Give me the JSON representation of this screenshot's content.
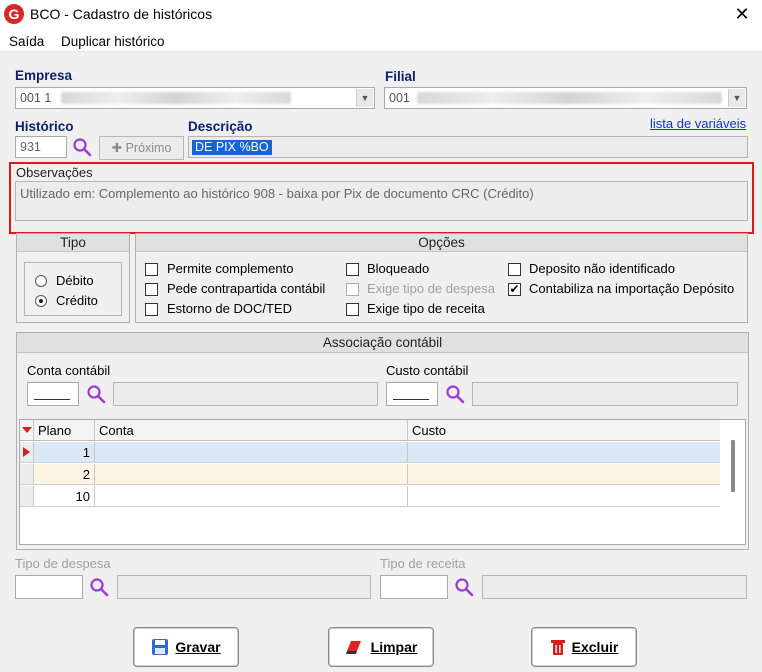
{
  "window": {
    "title": "BCO - Cadastro de históricos",
    "icon_letter": "G",
    "close_glyph": "✕"
  },
  "menu": [
    "Saída",
    "Duplicar histórico"
  ],
  "empresa": {
    "label": "Empresa",
    "value": "001 1"
  },
  "filial": {
    "label": "Filial",
    "value": "001"
  },
  "historico": {
    "label": "Histórico",
    "value": "931",
    "proximo_label": "Próximo"
  },
  "descricao": {
    "label": "Descrição",
    "value": "DE PIX %BO"
  },
  "variaveis_link": "lista de variáveis",
  "observacoes": {
    "label": "Observações",
    "value": "Utilizado em: Complemento ao histórico 908 - baixa por Pix de documento CRC (Crédito)"
  },
  "tipo": {
    "title": "Tipo",
    "options": [
      "Débito",
      "Crédito"
    ],
    "selected": "Crédito"
  },
  "opcoes": {
    "title": "Opções",
    "items": [
      {
        "label": "Permite complemento",
        "checked": false,
        "disabled": false
      },
      {
        "label": "Pede contrapartida contábil",
        "checked": false,
        "disabled": false
      },
      {
        "label": "Estorno de DOC/TED",
        "checked": false,
        "disabled": false
      },
      {
        "label": "Bloqueado",
        "checked": false,
        "disabled": false
      },
      {
        "label": "Exige tipo de despesa",
        "checked": false,
        "disabled": true
      },
      {
        "label": "Exige tipo de receita",
        "checked": false,
        "disabled": false
      },
      {
        "label": "Deposito não identificado",
        "checked": false,
        "disabled": false
      },
      {
        "label": "Contabiliza na importação Depósito",
        "checked": true,
        "disabled": false
      }
    ]
  },
  "associacao": {
    "title": "Associação contábil",
    "conta_label": "Conta contábil",
    "custo_label": "Custo contábil",
    "columns": [
      "Plano",
      "Conta",
      "Custo"
    ],
    "rows": [
      {
        "plano": "1",
        "conta": "",
        "custo": ""
      },
      {
        "plano": "2",
        "conta": "",
        "custo": ""
      },
      {
        "plano": "10",
        "conta": "",
        "custo": ""
      }
    ]
  },
  "tipo_despesa_label": "Tipo de despesa",
  "tipo_receita_label": "Tipo de receita",
  "buttons": {
    "gravar": "Gravar",
    "limpar": "Limpar",
    "excluir": "Excluir"
  },
  "colors": {
    "accent_label": "#0b1f6b",
    "highlight_box": "#e01818",
    "selected_text_bg": "#1565d8",
    "row_selected": "#dbe8f5",
    "row_alt": "#fdf5e4"
  }
}
